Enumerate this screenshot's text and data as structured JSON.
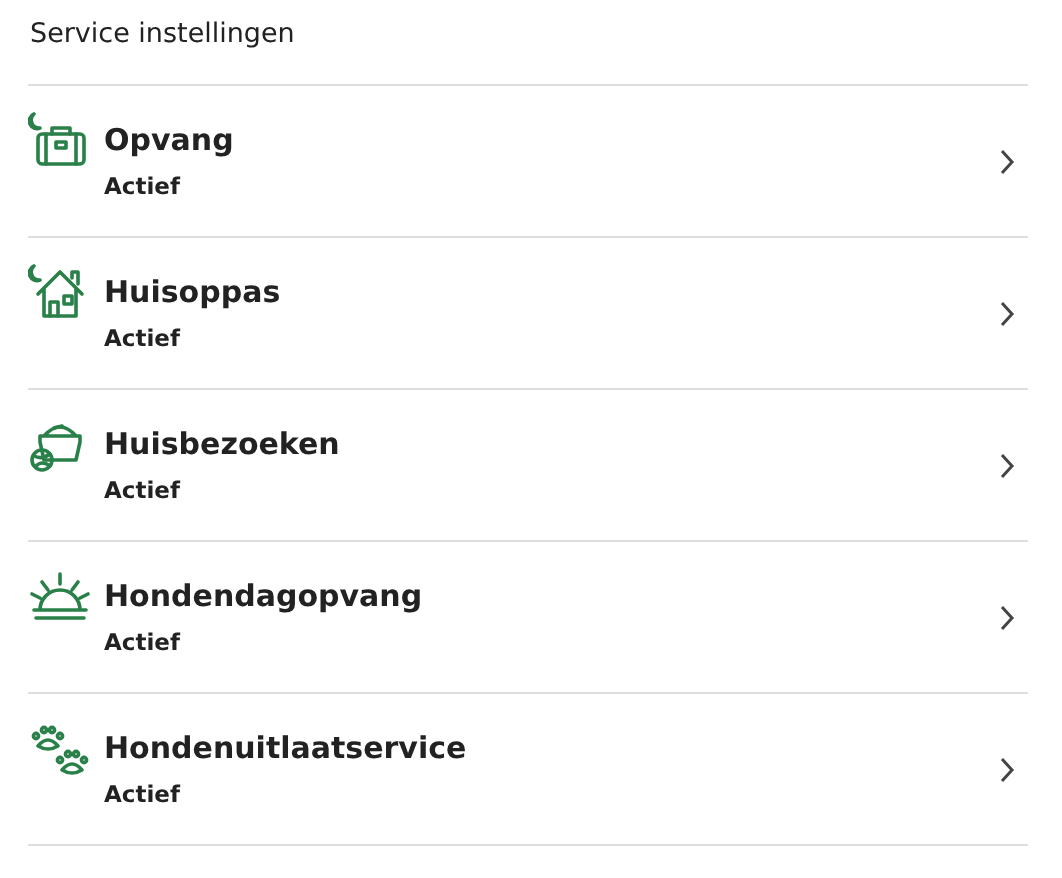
{
  "heading": "Service instellingen",
  "services": [
    {
      "kind": "boarding",
      "title": "Opvang",
      "status": "Actief"
    },
    {
      "kind": "house-sitting",
      "title": "Huisoppas",
      "status": "Actief"
    },
    {
      "kind": "drop-in",
      "title": "Huisbezoeken",
      "status": "Actief"
    },
    {
      "kind": "day-care",
      "title": "Hondendagopvang",
      "status": "Actief"
    },
    {
      "kind": "walking",
      "title": "Hondenuitlaatservice",
      "status": "Actief"
    }
  ]
}
